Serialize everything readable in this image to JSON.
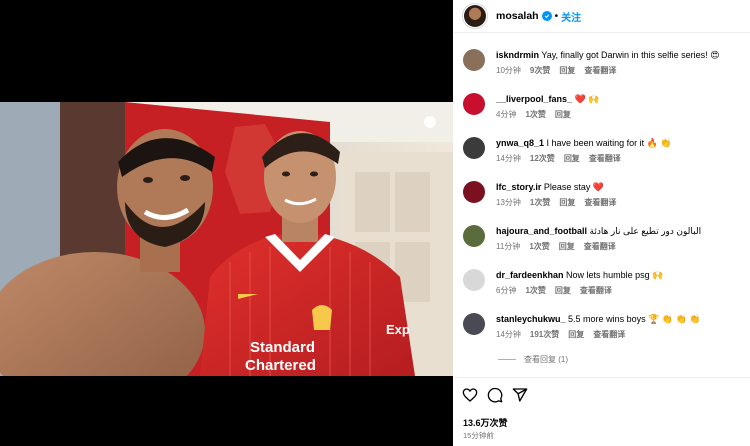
{
  "author": {
    "username": "mosalah",
    "follow_label": "关注",
    "dot": "•"
  },
  "comments": [
    {
      "user": "iskndrmin",
      "text": "Yay, finally got Darwin in this selfie series!",
      "emoji": "😍",
      "time": "10分钟",
      "likes": "9次赞",
      "reply": "回复",
      "translate": "查看翻译",
      "avatar_color": "#8a6f5a"
    },
    {
      "user": "__liverpool_fans_",
      "text": "",
      "emoji": "❤️ 🙌",
      "time": "4分钟",
      "likes": "1次赞",
      "reply": "回复",
      "translate": "",
      "avatar_color": "#c8102e"
    },
    {
      "user": "ynwa_q8_1",
      "text": "I have been waiting for it",
      "emoji": "🔥 👏",
      "time": "14分钟",
      "likes": "12次赞",
      "reply": "回复",
      "translate": "查看翻译",
      "avatar_color": "#3b3b3b"
    },
    {
      "user": "lfc_story.ir",
      "text": "Please stay",
      "emoji": "❤️",
      "time": "13分钟",
      "likes": "1次赞",
      "reply": "回复",
      "translate": "查看翻译",
      "avatar_color": "#7a1020"
    },
    {
      "user": "hajoura_and_football",
      "text": "البالون دور تطيع على نار هادئة",
      "emoji": "",
      "time": "11分钟",
      "likes": "1次赞",
      "reply": "回复",
      "translate": "查看翻译",
      "avatar_color": "#5a6b3c"
    },
    {
      "user": "dr_fardeenkhan",
      "text": "Now lets humble psg",
      "emoji": "🙌",
      "time": "6分钟",
      "likes": "1次赞",
      "reply": "回复",
      "translate": "查看翻译",
      "avatar_color": "#d8d8d8"
    },
    {
      "user": "stanleychukwu_",
      "text": "5.5 more wins boys",
      "emoji": "🏆 👏 👏 👏",
      "time": "14分钟",
      "likes": "191次赞",
      "reply": "回复",
      "translate": "查看翻译",
      "avatar_color": "#4a4a55"
    }
  ],
  "view_replies": "查看回复 (1)",
  "likes_count": "13.6万次赞",
  "posted": "15分钟前",
  "icons": [
    "heart-icon",
    "comment-icon",
    "share-icon"
  ],
  "colors": {
    "accent": "#0095f6",
    "liverpool_red": "#c8102e"
  }
}
